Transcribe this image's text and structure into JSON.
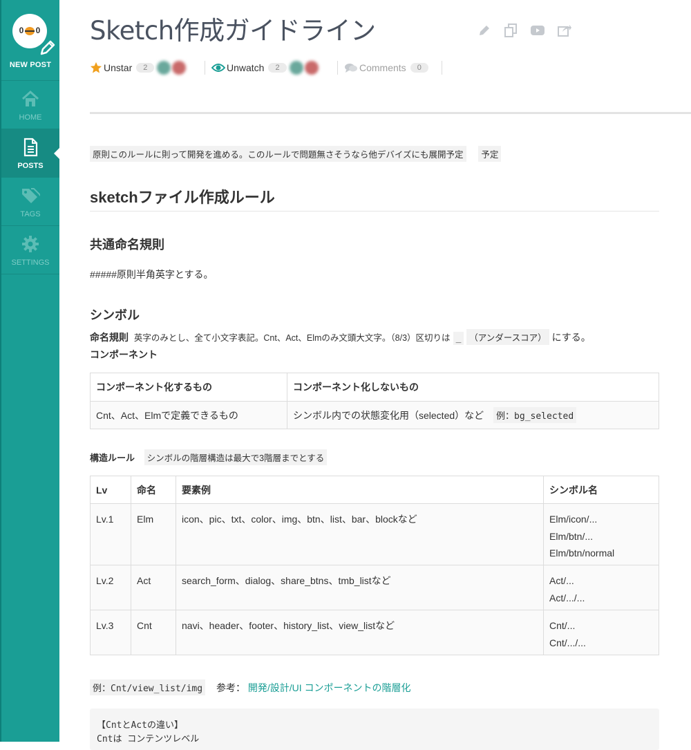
{
  "sidebar": {
    "new_post": "NEW POST",
    "items": [
      {
        "label": "HOME",
        "icon": "home-icon"
      },
      {
        "label": "POSTS",
        "icon": "document-icon",
        "active": true
      },
      {
        "label": "TAGS",
        "icon": "tag-icon"
      },
      {
        "label": "SETTINGS",
        "icon": "gear-icon"
      }
    ]
  },
  "post": {
    "title": "Sketch作成ガイドライン",
    "actions": [
      "pencil-icon",
      "copy-icon",
      "youtube-icon",
      "share-icon"
    ],
    "star_label": "Unstar",
    "star_count": "2",
    "watch_label": "Unwatch",
    "watch_count": "2",
    "comments_label": "Comments",
    "comments_count": "0"
  },
  "content": {
    "note_main": "原則このルールに則って開発を進める。このルールで問題無さそうなら他デバイズにも展開予定",
    "note_tag": "予定",
    "h1": "sketchファイル作成ルール",
    "common_heading": "共通命名規則",
    "common_text": "#####原則半角英字とする。",
    "symbol_heading": "シンボル",
    "naming_label": "命名規則",
    "naming_text_a": "英字のみとし、全て小文字表記。Cnt、Act、Elmのみ文頭大文字。（8/3）区切りは",
    "naming_code": "_",
    "naming_paren": "（アンダースコア）",
    "naming_end": "にする。",
    "component_label": "コンポーネント",
    "table1": {
      "headers": [
        "コンポーネント化するもの",
        "コンポーネント化しないもの"
      ],
      "row": [
        "Cnt、Act、Elmで定義できるもの",
        "シンボル内での状態変化用（selected）など"
      ],
      "row_code": "例：bg_selected"
    },
    "structure_label": "構造ルール",
    "structure_tag": "シンボルの階層構造は最大で3階層までとする",
    "table2": {
      "headers": [
        "Lv",
        "命名",
        "要素例",
        "シンボル名"
      ],
      "rows": [
        {
          "lv": "Lv.1",
          "name": "Elm",
          "examples": "icon、pic、txt、color、img、btn、list、bar、blockなど",
          "symbols": [
            "Elm/icon/...",
            "Elm/btn/...",
            "Elm/btn/normal"
          ]
        },
        {
          "lv": "Lv.2",
          "name": "Act",
          "examples": "search_form、dialog、share_btns、tmb_listなど",
          "symbols": [
            "Act/...",
            "Act/.../..."
          ]
        },
        {
          "lv": "Lv.3",
          "name": "Cnt",
          "examples": "navi、header、footer、history_list、view_listなど",
          "symbols": [
            "Cnt/...",
            "Cnt/.../..."
          ]
        }
      ]
    },
    "example_code": "例：Cnt/view_list/img",
    "ref_label": "参考：",
    "ref_link": "開発/設計/UI コンポーネントの階層化",
    "code_line1": "【CntとActの違い】",
    "code_line2": "Cntは  コンテンツレベル"
  },
  "colors": {
    "sidebar": "#1a9e95",
    "accent": "#1a9e95",
    "star": "#f0a01e"
  }
}
